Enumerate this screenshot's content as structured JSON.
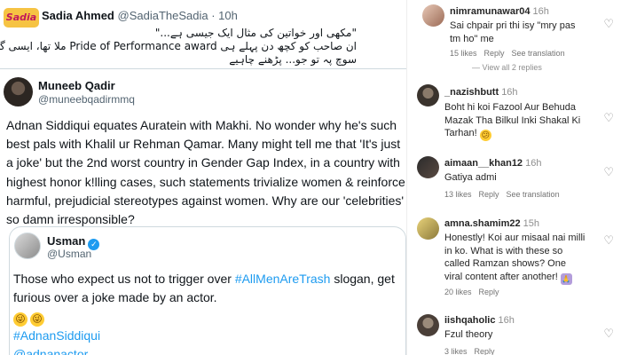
{
  "tweet_sadia": {
    "logo_text": "Sadia",
    "name": "Sadia Ahmed",
    "handle": "@SadiaTheSadia",
    "time": "· 10h",
    "line1": "\"مکھی اور خواتین کی مثال ایک جیسی ہے...\"",
    "line2": "ان صاحب کو کچھ دن پہلے ہی Pride of Performance award ملا تھا، ایسی گھٹیا",
    "line3": "سوچ پہ تو جو... پڑھنے چاہیے"
  },
  "tweet_muneeb": {
    "name": "Muneeb Qadir",
    "handle": "@muneebqadirmmq",
    "body": "Adnan Siddiqui equates Auratein with Makhi. No wonder why he's such best pals with Khalil ur Rehman Qamar. Many might tell me that 'It's just a joke' but the 2nd worst country in Gender Gap Index, in a country with highest honor k!lling cases, such statements trivialize women & reinforce harmful, prejudicial stereotypes against women. Why are our 'celebrities' so damn irresponsible?"
  },
  "quoted_tweet": {
    "name": "Usman",
    "verified_glyph": "✓",
    "handle": "@Usman",
    "body_part1": "Those who expect us not to trigger over ",
    "hashtag_men": "#AllMenAreTrash",
    "body_part2": " slogan, get furious over a joke made by an actor.",
    "emoji1": "😜",
    "emoji2": "😜",
    "hashtag_adnan": "#AdnanSiddiqui",
    "mention_actor": "@adnanactor"
  },
  "comments": [
    {
      "username": "nimramunawar04",
      "time": "16h",
      "text": "Sai chpair pri thi isy \"mry pas tm ho\" me",
      "likes": "15 likes",
      "reply": "Reply",
      "translate": "See translation",
      "hidden_replies": "— View all 2 replies"
    },
    {
      "username": "_nazishbutt",
      "time": "16h",
      "text": "Boht hi koi Fazool Aur Behuda Mazak Tha Bilkul Inki Shakal Ki Tarhan!",
      "emoji": "😕"
    },
    {
      "username": "aimaan__khan12",
      "time": "16h",
      "text": "Gatiya admi",
      "likes": "13 likes",
      "reply": "Reply",
      "translate": "See translation"
    },
    {
      "username": "amna.shamim22",
      "time": "15h",
      "text": "Honestly! Koi aur misaal nai milli in ko. What is with these so called Ramzan shows? One viral content after another!",
      "emoji": "🙏",
      "likes": "20 likes",
      "reply": "Reply"
    },
    {
      "username": "iishqaholic",
      "time": "16h",
      "text": "Fzul theory",
      "likes": "3 likes",
      "reply": "Reply"
    }
  ],
  "icons": {
    "heart": "♡"
  },
  "colors": {
    "link_blue": "#1d9bf0",
    "verified_blue": "#1d9bf0",
    "border": "#cfd9de",
    "meta_gray": "#737373"
  }
}
